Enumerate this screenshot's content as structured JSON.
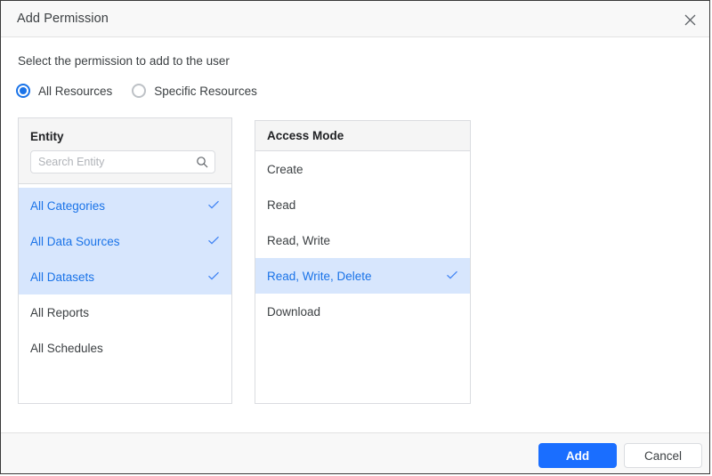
{
  "dialog": {
    "title": "Add Permission",
    "close_icon": "close-icon",
    "subtitle": "Select the permission to add to the user"
  },
  "scope": {
    "options": [
      {
        "label": "All Resources",
        "selected": true
      },
      {
        "label": "Specific Resources",
        "selected": false
      }
    ]
  },
  "entity_panel": {
    "title": "Entity",
    "search": {
      "placeholder": "Search Entity",
      "value": "",
      "icon": "search-icon"
    },
    "items": [
      {
        "label": "All Categories",
        "selected": true
      },
      {
        "label": "All Data Sources",
        "selected": true
      },
      {
        "label": "All Datasets",
        "selected": true
      },
      {
        "label": "All Reports",
        "selected": false
      },
      {
        "label": "All Schedules",
        "selected": false
      }
    ]
  },
  "access_panel": {
    "title": "Access Mode",
    "items": [
      {
        "label": "Create",
        "selected": false
      },
      {
        "label": "Read",
        "selected": false
      },
      {
        "label": "Read, Write",
        "selected": false
      },
      {
        "label": "Read, Write, Delete",
        "selected": true
      },
      {
        "label": "Download",
        "selected": false
      }
    ]
  },
  "footer": {
    "add_label": "Add",
    "cancel_label": "Cancel"
  },
  "colors": {
    "accent": "#1a73e8",
    "primary_button": "#1a6eff",
    "selection_bg": "#d7e6fd"
  }
}
